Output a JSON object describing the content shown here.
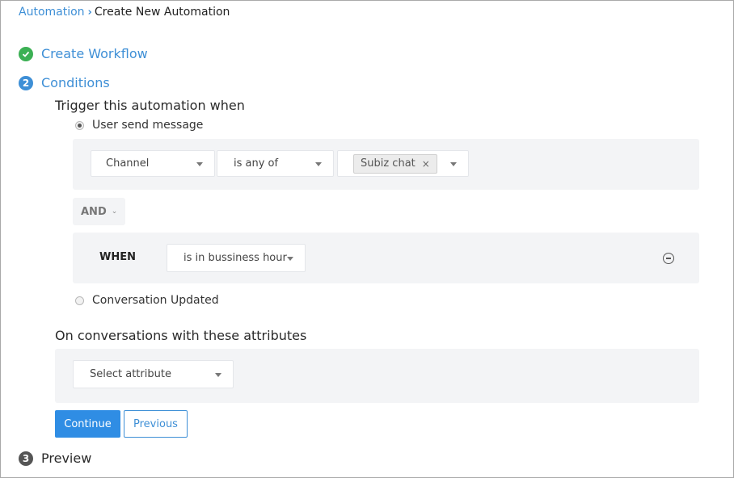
{
  "breadcrumb": {
    "parent": "Automation",
    "current": "Create New Automation"
  },
  "steps": {
    "create_workflow": {
      "label": "Create Workflow",
      "icon": "check-circle-icon",
      "status": "done",
      "color": "#3cb054"
    },
    "conditions": {
      "number": "2",
      "label": "Conditions",
      "status": "active",
      "color": "#3e8fd6"
    },
    "preview": {
      "number": "3",
      "label": "Preview",
      "status": "pending",
      "color": "#555555"
    }
  },
  "trigger": {
    "title": "Trigger this automation when",
    "options": [
      {
        "label": "User send message",
        "selected": true
      },
      {
        "label": "Conversation Updated",
        "selected": false
      }
    ],
    "condition": {
      "field": "Channel",
      "operator": "is any of",
      "values": [
        {
          "label": "Subiz chat",
          "remove": "×"
        }
      ]
    },
    "connector": "AND",
    "when": {
      "label": "WHEN",
      "value": "is in bussiness hour"
    }
  },
  "attributes": {
    "title": "On conversations with these attributes",
    "select_placeholder": "Select attribute"
  },
  "actions": {
    "continue_label": "Continue",
    "previous_label": "Previous"
  },
  "colors": {
    "accent": "#3e8fd6",
    "primary_button": "#2f8de4",
    "success": "#3cb054",
    "panel_bg": "#f3f4f6"
  }
}
